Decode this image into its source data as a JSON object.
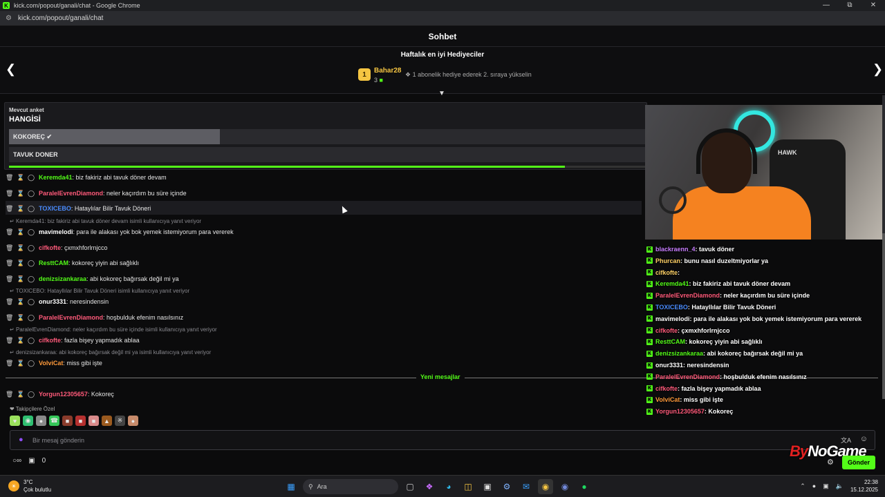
{
  "browser": {
    "window_title": "kick.com/popout/ganali/chat - Google Chrome",
    "url": "kick.com/popout/ganali/chat"
  },
  "chat": {
    "header": "Sohbet",
    "gifters_title": "Haftalık en iyi Hediyeciler",
    "top_gifter": {
      "rank": "1",
      "name": "Bahar28",
      "count": "3"
    },
    "upgrade_hint": "1 abonelik hediye ederek 2. sıraya yükselin"
  },
  "poll": {
    "label": "Mevcut anket",
    "question": "HANGİSİ",
    "options": [
      {
        "text": "KOKOREÇ",
        "share": 0.33
      },
      {
        "text": "TAVUK DONER",
        "share": 0
      }
    ],
    "time_left": 0.87
  },
  "messages": [
    {
      "user": "Keremda41",
      "color": "#53fc18",
      "text": ": biz fakiriz abi tavuk döner devam"
    },
    {
      "user": "ParalelEvrenDiamond",
      "color": "#ff5a7a",
      "text": ": neler kaçırdım bu süre içinde"
    },
    {
      "user": "TOXICEBO",
      "color": "#4a8cff",
      "text": ": Hataylılar Bilir Tavuk Döneri"
    },
    {
      "reply": "Keremda41: biz fakiriz abi tavuk döner devam isimli kullanıcıya yanıt veriyor"
    },
    {
      "user": "mavimelodi",
      "color": "#ffffff",
      "text": ": para ile alakası yok bok yemek istemiyorum para vererek"
    },
    {
      "user": "cifkofte",
      "color": "#ff5a7a",
      "text": ": çxmxhforlrnjcco"
    },
    {
      "user": "ResttCAM",
      "color": "#53fc18",
      "text": ": kokoreç yiyin abi sağlıklı"
    },
    {
      "user": "denizsizankaraa",
      "color": "#53fc18",
      "text": ": abi kokoreç bağırsak değil mi ya"
    },
    {
      "reply": "TOXICEBO: Hatayllılar Bilir Tavuk Döneri isimli kullanıcıya yanıt veriyor"
    },
    {
      "user": "onur3331",
      "color": "#ffffff",
      "text": ": neresindensin"
    },
    {
      "user": "ParalelEvrenDiamond",
      "color": "#ff5a7a",
      "text": ": hoşbulduk efenim nasılsınız"
    },
    {
      "reply": "ParalelEvrenDiamond: neler kaçırdım bu süre içinde isimli kullanıcıya yanıt veriyor"
    },
    {
      "user": "cifkofte",
      "color": "#ff5a7a",
      "text": ": fazla bişey yapmadık ablaa"
    },
    {
      "reply": "denizsizankaraa: abi kokoreç bağırsak değil mi ya isimli kullanıcıya yanıt veriyor"
    },
    {
      "user": "VolviCat",
      "color": "#ff9a3a",
      "text": ": miss gibi işte"
    },
    {
      "user": "Yorgun12305657",
      "color": "#ff5a7a",
      "text": ": Kokoreç"
    }
  ],
  "new_messages_label": "Yeni mesajlar",
  "followers_label": "Takipçilere Özel",
  "input": {
    "placeholder": "Bir mesaj gönderin"
  },
  "bottom": {
    "viewers": "0",
    "send_label": "Gönder"
  },
  "watermark": {
    "by": "By",
    "rest": "NoGame"
  },
  "overlay": [
    {
      "user": "blackraenn_4",
      "color": "#c77dff",
      "text": ": tavuk döner"
    },
    {
      "user": "Phurcan",
      "color": "#ffd166",
      "text": ": bunu nasıl duzeltmiyorlar ya"
    },
    {
      "user": "cifkofte",
      "color": "#ffd166",
      "text": ": "
    },
    {
      "user": "Keremda41",
      "color": "#53fc18",
      "text": ": biz fakiriz abi tavuk döner devam"
    },
    {
      "user": "ParalelEvrenDiamond",
      "color": "#ff5a7a",
      "text": ": neler kaçırdım bu süre içinde"
    },
    {
      "user": "TOXICEBO",
      "color": "#4a8cff",
      "text": ": Hatayllılar Bilir Tavuk Döneri"
    },
    {
      "user": "mavimelodi",
      "color": "#ffffff",
      "text": ": para ile alakası yok bok yemek istemiyorum para vererek"
    },
    {
      "user": "cifkofte",
      "color": "#ff5a7a",
      "text": ": çxmxhforlrnjcco"
    },
    {
      "user": "ResttCAM",
      "color": "#53fc18",
      "text": ": kokoreç yiyin abi sağlıklı"
    },
    {
      "user": "denizsizankaraa",
      "color": "#53fc18",
      "text": ": abi kokoreç bağırsak değil mi ya"
    },
    {
      "user": "onur3331",
      "color": "#ffffff",
      "text": ": neresindensin"
    },
    {
      "user": "ParalelEvrenDiamond",
      "color": "#ff5a7a",
      "text": ": hoşbulduk efenim nasılsınız"
    },
    {
      "user": "cifkofte",
      "color": "#ff5a7a",
      "text": ": fazla bişey yapmadık ablaa"
    },
    {
      "user": "VolviCat",
      "color": "#ff9a3a",
      "text": ": miss gibi işte"
    },
    {
      "user": "Yorgun12305657",
      "color": "#ff5a7a",
      "text": ": Kokoreç"
    }
  ],
  "cam": {
    "chair_brand": "HAWK"
  },
  "taskbar": {
    "temp": "3°C",
    "weather": "Çok bulutlu",
    "search": "Ara",
    "time": "22:38",
    "date": "15.12.2025"
  }
}
